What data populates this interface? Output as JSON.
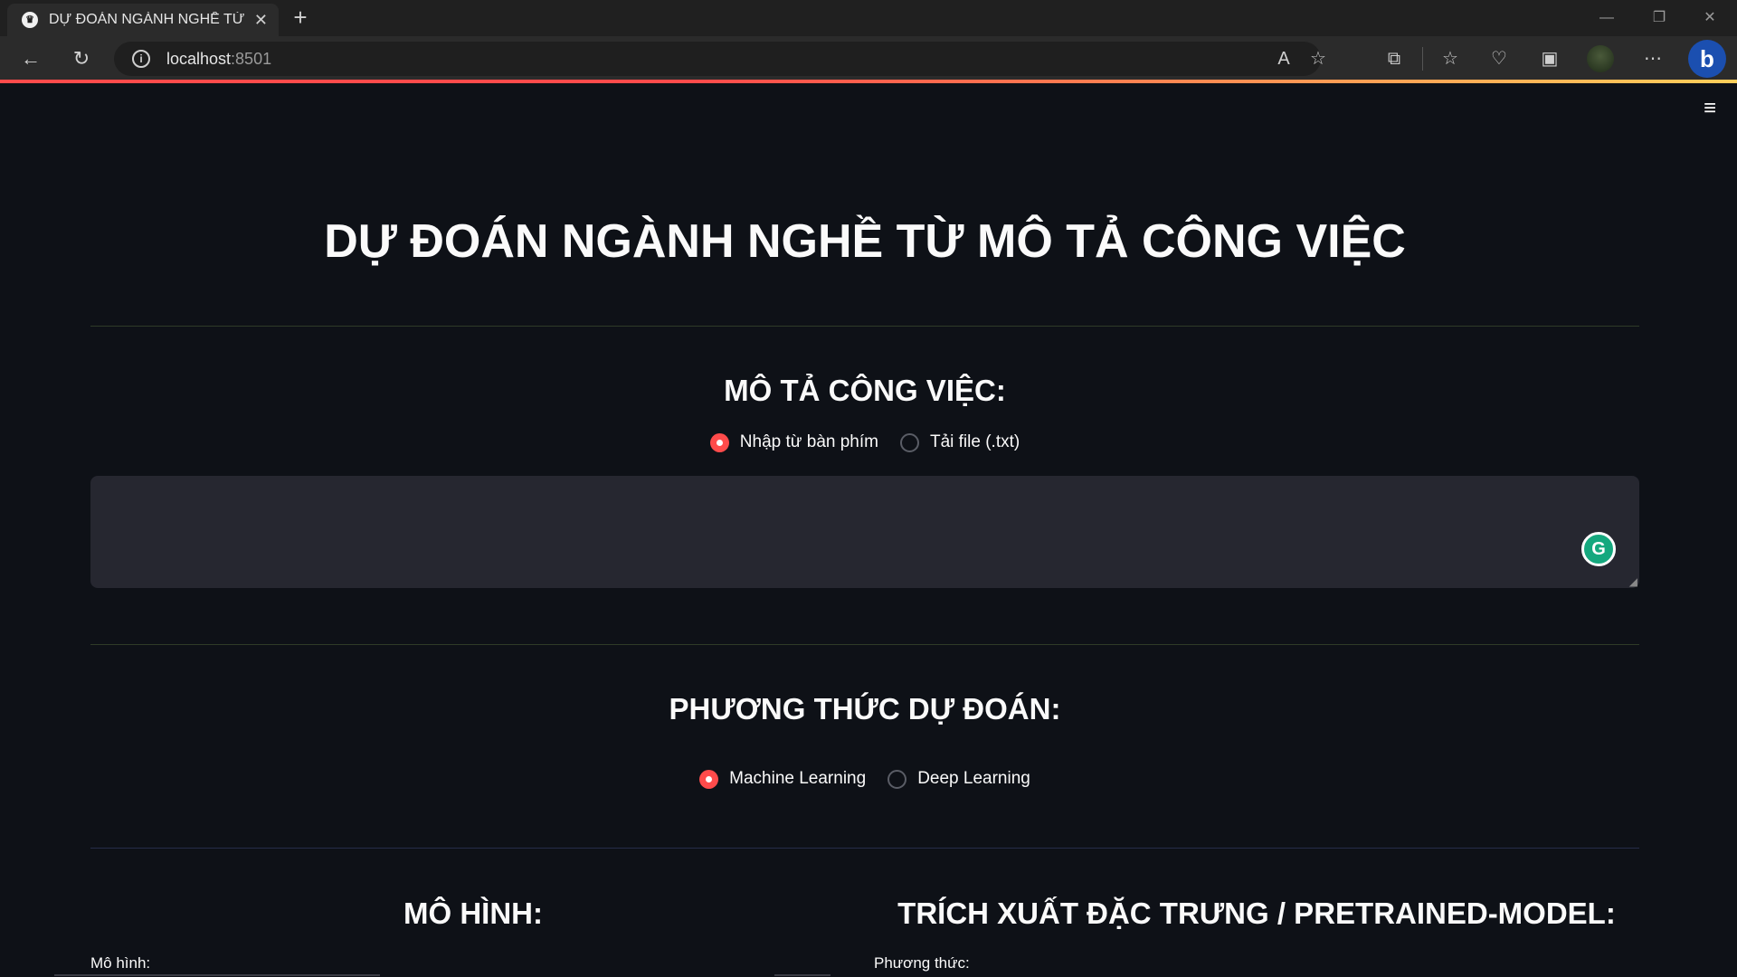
{
  "browser": {
    "tab_title": "DỰ ĐOÁN NGÀNH NGHỀ TỪ MÔ TẢ CÔNG VIỆC",
    "url_host": "localhost",
    "url_port": ":8501"
  },
  "page": {
    "title": "DỰ ĐOÁN NGÀNH NGHỀ TỪ MÔ TẢ CÔNG VIỆC"
  },
  "description": {
    "heading": "MÔ TẢ CÔNG VIỆC:",
    "options": [
      "Nhập từ bàn phím",
      "Tải file (.txt)"
    ],
    "selected": "Nhập từ bàn phím",
    "input_value": ""
  },
  "method": {
    "heading": "PHƯƠNG THỨC DỰ ĐOÁN:",
    "options": [
      "Machine Learning",
      "Deep Learning"
    ],
    "selected": "Machine Learning"
  },
  "model": {
    "heading": "MÔ HÌNH:",
    "field_label": "Mô hình:"
  },
  "feature": {
    "heading": "TRÍCH XUẤT ĐẶC TRƯNG / PRETRAINED-MODEL:",
    "field_label": "Phương thức:"
  },
  "colors": {
    "background": "#0e1117",
    "accent": "#ff4b4b",
    "text": "#fafafa",
    "input_bg": "#262730"
  }
}
